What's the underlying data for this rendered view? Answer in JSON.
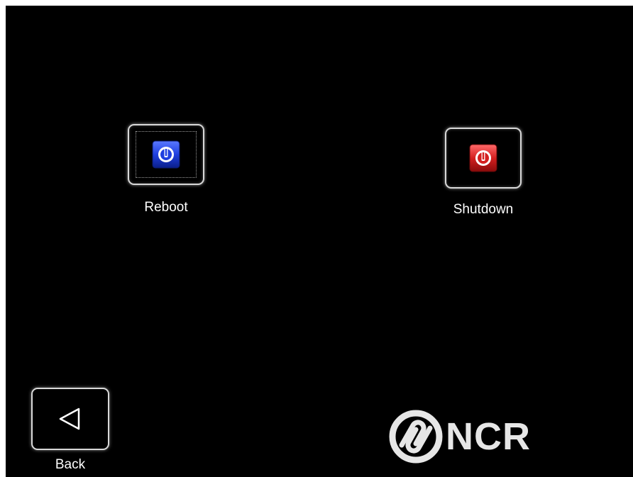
{
  "actions": {
    "reboot": {
      "label": "Reboot",
      "icon": "power-icon",
      "color": "#1f3fe0"
    },
    "shutdown": {
      "label": "Shutdown",
      "icon": "power-icon",
      "color": "#d42020"
    }
  },
  "navigation": {
    "back": {
      "label": "Back",
      "icon": "triangle-left-icon"
    }
  },
  "branding": {
    "logo_text": "NCR"
  },
  "colors": {
    "background": "#000000",
    "tile_border": "#d8d8d8",
    "text": "#ffffff"
  }
}
